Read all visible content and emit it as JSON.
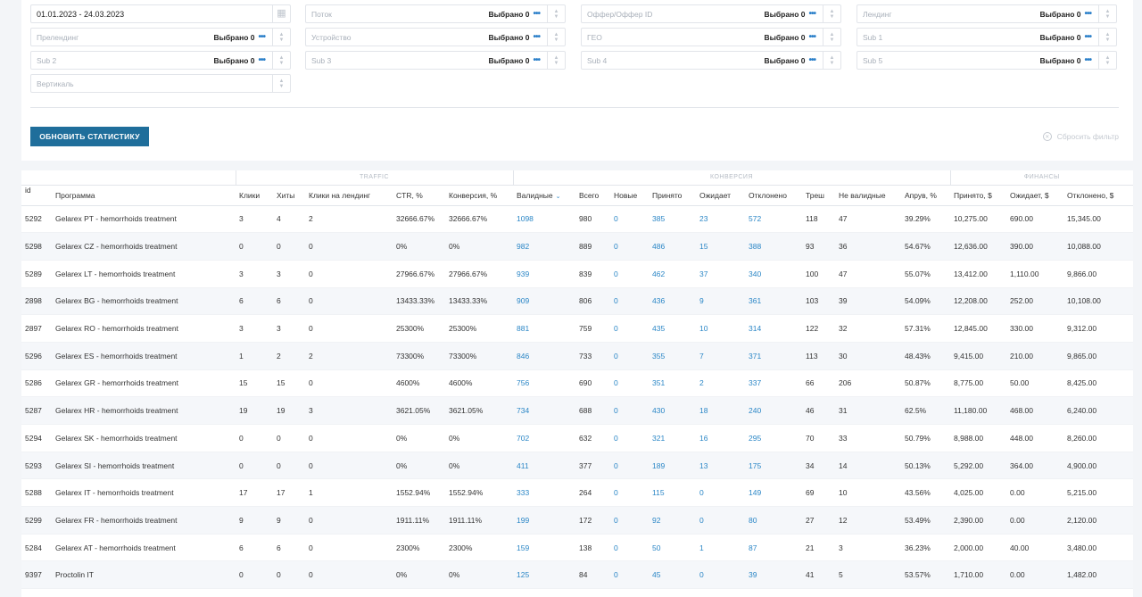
{
  "filters": {
    "date": {
      "value": "01.01.2023 - 24.03.2023",
      "icon": "calendar-icon"
    },
    "selected_label": "Выбрано 0",
    "items": [
      {
        "placeholder": "Поток"
      },
      {
        "placeholder": "Оффер/Оффер ID"
      },
      {
        "placeholder": "Лендинг"
      },
      {
        "placeholder": "Прелендинг"
      },
      {
        "placeholder": "Устройство"
      },
      {
        "placeholder": "ГЕО"
      },
      {
        "placeholder": "Sub 1"
      },
      {
        "placeholder": "Sub 2"
      },
      {
        "placeholder": "Sub 3"
      },
      {
        "placeholder": "Sub 4"
      },
      {
        "placeholder": "Sub 5"
      }
    ],
    "vertical": {
      "placeholder": "Вертикаль"
    }
  },
  "actions": {
    "update_label": "ОБНОВИТЬ СТАТИСТИКУ",
    "reset_label": "Сбросить фильтр"
  },
  "table": {
    "groups": {
      "traffic": "TRAFFIC",
      "conversion": "КОНВЕРСИЯ",
      "finance": "ФИНАНСЫ"
    },
    "columns": [
      "id",
      "Программа",
      "Клики",
      "Хиты",
      "Клики на лендинг",
      "CTR, %",
      "Конверсия, %",
      "Валидные",
      "Всего",
      "Новые",
      "Принято",
      "Ожидает",
      "Отклонено",
      "Треш",
      "Не валидные",
      "Апрув, %",
      "Принято, $",
      "Ожидает, $",
      "Отклонено, $"
    ],
    "sort_icon": "chevron-down-icon",
    "rows": [
      [
        "5292",
        "Gelarex PT - hemorrhoids treatment",
        "3",
        "4",
        "2",
        "32666.67%",
        "32666.67%",
        "1098",
        "980",
        "0",
        "385",
        "23",
        "572",
        "118",
        "47",
        "39.29%",
        "10,275.00",
        "690.00",
        "15,345.00"
      ],
      [
        "5298",
        "Gelarex CZ - hemorrhoids treatment",
        "0",
        "0",
        "0",
        "0%",
        "0%",
        "982",
        "889",
        "0",
        "486",
        "15",
        "388",
        "93",
        "36",
        "54.67%",
        "12,636.00",
        "390.00",
        "10,088.00"
      ],
      [
        "5289",
        "Gelarex LT - hemorrhoids treatment",
        "3",
        "3",
        "0",
        "27966.67%",
        "27966.67%",
        "939",
        "839",
        "0",
        "462",
        "37",
        "340",
        "100",
        "47",
        "55.07%",
        "13,412.00",
        "1,110.00",
        "9,866.00"
      ],
      [
        "2898",
        "Gelarex BG - hemorrhoids treatment",
        "6",
        "6",
        "0",
        "13433.33%",
        "13433.33%",
        "909",
        "806",
        "0",
        "436",
        "9",
        "361",
        "103",
        "39",
        "54.09%",
        "12,208.00",
        "252.00",
        "10,108.00"
      ],
      [
        "2897",
        "Gelarex RO - hemorrhoids treatment",
        "3",
        "3",
        "0",
        "25300%",
        "25300%",
        "881",
        "759",
        "0",
        "435",
        "10",
        "314",
        "122",
        "32",
        "57.31%",
        "12,845.00",
        "330.00",
        "9,312.00"
      ],
      [
        "5296",
        "Gelarex ES - hemorrhoids treatment",
        "1",
        "2",
        "2",
        "73300%",
        "73300%",
        "846",
        "733",
        "0",
        "355",
        "7",
        "371",
        "113",
        "30",
        "48.43%",
        "9,415.00",
        "210.00",
        "9,865.00"
      ],
      [
        "5286",
        "Gelarex GR - hemorrhoids treatment",
        "15",
        "15",
        "0",
        "4600%",
        "4600%",
        "756",
        "690",
        "0",
        "351",
        "2",
        "337",
        "66",
        "206",
        "50.87%",
        "8,775.00",
        "50.00",
        "8,425.00"
      ],
      [
        "5287",
        "Gelarex HR - hemorrhoids treatment",
        "19",
        "19",
        "3",
        "3621.05%",
        "3621.05%",
        "734",
        "688",
        "0",
        "430",
        "18",
        "240",
        "46",
        "31",
        "62.5%",
        "11,180.00",
        "468.00",
        "6,240.00"
      ],
      [
        "5294",
        "Gelarex SK - hemorrhoids treatment",
        "0",
        "0",
        "0",
        "0%",
        "0%",
        "702",
        "632",
        "0",
        "321",
        "16",
        "295",
        "70",
        "33",
        "50.79%",
        "8,988.00",
        "448.00",
        "8,260.00"
      ],
      [
        "5293",
        "Gelarex SI - hemorrhoids treatment",
        "0",
        "0",
        "0",
        "0%",
        "0%",
        "411",
        "377",
        "0",
        "189",
        "13",
        "175",
        "34",
        "14",
        "50.13%",
        "5,292.00",
        "364.00",
        "4,900.00"
      ],
      [
        "5288",
        "Gelarex IT - hemorrhoids treatment",
        "17",
        "17",
        "1",
        "1552.94%",
        "1552.94%",
        "333",
        "264",
        "0",
        "115",
        "0",
        "149",
        "69",
        "10",
        "43.56%",
        "4,025.00",
        "0.00",
        "5,215.00"
      ],
      [
        "5299",
        "Gelarex FR - hemorrhoids treatment",
        "9",
        "9",
        "0",
        "1911.11%",
        "1911.11%",
        "199",
        "172",
        "0",
        "92",
        "0",
        "80",
        "27",
        "12",
        "53.49%",
        "2,390.00",
        "0.00",
        "2,120.00"
      ],
      [
        "5284",
        "Gelarex AT - hemorrhoids treatment",
        "6",
        "6",
        "0",
        "2300%",
        "2300%",
        "159",
        "138",
        "0",
        "50",
        "1",
        "87",
        "21",
        "3",
        "36.23%",
        "2,000.00",
        "40.00",
        "3,480.00"
      ],
      [
        "9397",
        "Proctolin IT",
        "0",
        "0",
        "0",
        "0%",
        "0%",
        "125",
        "84",
        "0",
        "45",
        "0",
        "39",
        "41",
        "5",
        "53.57%",
        "1,710.00",
        "0.00",
        "1,482.00"
      ]
    ]
  }
}
